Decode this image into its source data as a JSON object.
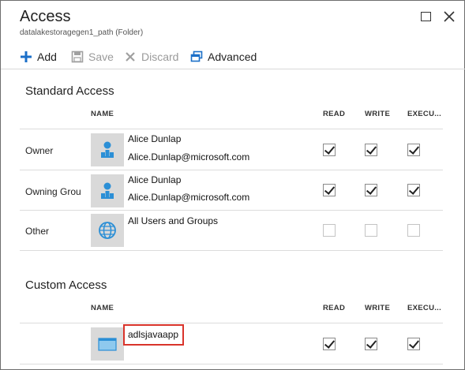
{
  "panel": {
    "title": "Access",
    "subtitle": "datalakestoragegen1_path (Folder)"
  },
  "toolbar": {
    "add_label": "Add",
    "save_label": "Save",
    "discard_label": "Discard",
    "advanced_label": "Advanced"
  },
  "headers": {
    "name": "NAME",
    "read": "READ",
    "write": "WRITE",
    "execute": "EXECU..."
  },
  "standard_access": {
    "title": "Standard Access",
    "rows": [
      {
        "label": "Owner",
        "icon": "user-icon",
        "name": "Alice Dunlap",
        "email": "Alice.Dunlap@microsoft.com",
        "read": true,
        "write": true,
        "execute": true
      },
      {
        "label": "Owning Grou",
        "icon": "user-icon",
        "name": "Alice Dunlap",
        "email": "Alice.Dunlap@microsoft.com",
        "read": true,
        "write": true,
        "execute": true
      },
      {
        "label": "Other",
        "icon": "globe-icon",
        "name": "All Users and Groups",
        "email": "",
        "read": false,
        "write": false,
        "execute": false
      }
    ]
  },
  "custom_access": {
    "title": "Custom Access",
    "rows": [
      {
        "label": "",
        "icon": "app-icon",
        "name": "adlsjavaapp",
        "email": "",
        "read": true,
        "write": true,
        "execute": true
      }
    ]
  },
  "colors": {
    "accent": "#1b6fc8",
    "highlight": "#d9342b",
    "avatar_bg": "#d9d9d9"
  }
}
